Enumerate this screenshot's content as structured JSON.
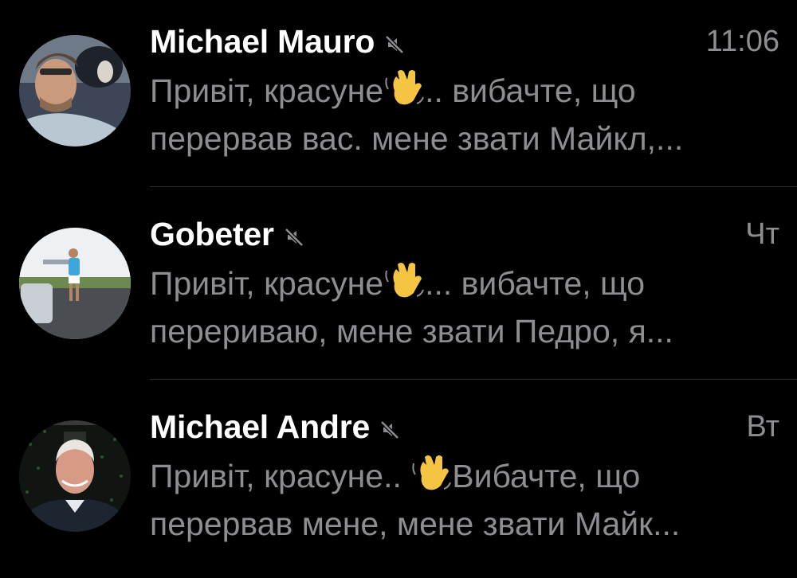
{
  "chats": [
    {
      "name": "Michael Mauro",
      "time": "11:06",
      "muted": true,
      "preview_line1_a": "Привіт, красуне",
      "preview_emoji": "waving-hand",
      "preview_line1_b": ".. вибачте, що",
      "preview_line2": "перервав вас. мене звати Майкл,..."
    },
    {
      "name": "Gobeter",
      "time": "Чт",
      "muted": true,
      "preview_line1_a": "Привіт, красуне",
      "preview_emoji": "waving-hand",
      "preview_line1_b": "... вибачте, що",
      "preview_line2": "перериваю, мене звати Педро, я..."
    },
    {
      "name": "Michael Andre",
      "time": "Вт",
      "muted": true,
      "preview_line1_a": "Привіт, красуне.. ",
      "preview_emoji": "waving-hand",
      "preview_line1_b": "Вибачте, що",
      "preview_line2": "перервав мене, мене звати Майк..."
    }
  ],
  "colors": {
    "background": "#000000",
    "name_text": "#ffffff",
    "secondary_text": "#8d8d92",
    "divider": "#2c2c2e"
  }
}
